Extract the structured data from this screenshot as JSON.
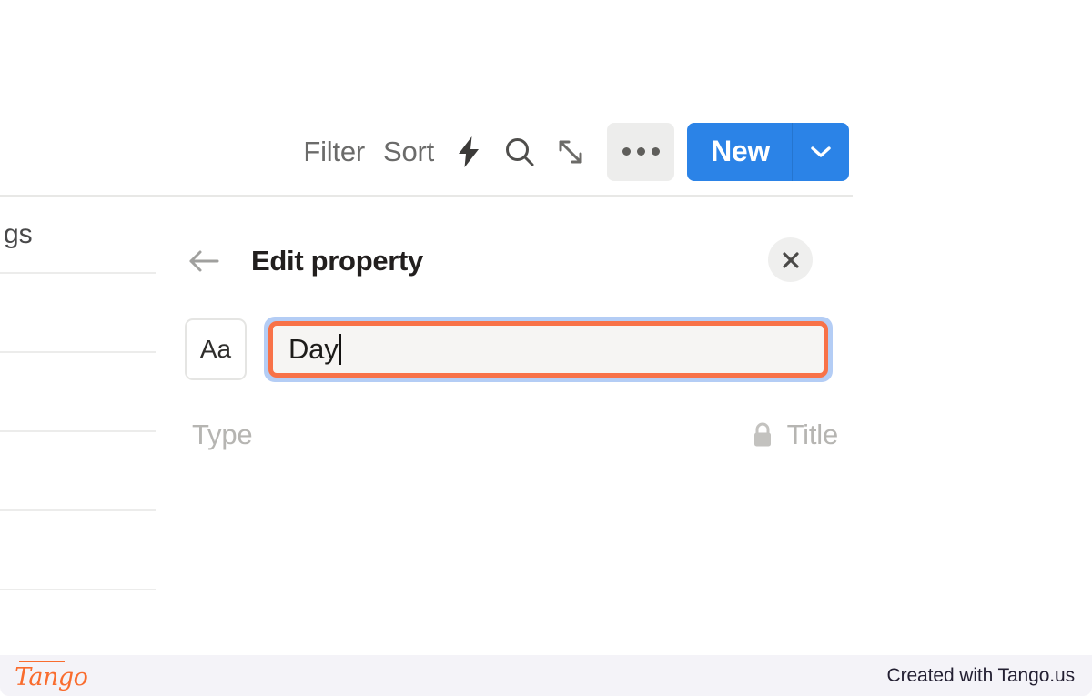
{
  "toolbar": {
    "filter_label": "Filter",
    "sort_label": "Sort",
    "automation_icon": "lightning-bolt-icon",
    "search_icon": "search-icon",
    "expand_icon": "expand-arrows-icon",
    "more_icon": "ellipsis-icon",
    "new_label": "New",
    "new_caret_icon": "chevron-down-icon",
    "new_button_color": "#2b83e7"
  },
  "table": {
    "rows": [
      {
        "text": "gs"
      },
      {
        "text": ""
      },
      {
        "text": ""
      },
      {
        "text": ""
      },
      {
        "text": ""
      },
      {
        "text": ""
      }
    ]
  },
  "panel": {
    "back_icon": "arrow-left-icon",
    "title": "Edit property",
    "close_icon": "close-icon",
    "type_chip_label": "Aa",
    "name_input": {
      "value": "Day",
      "placeholder": "Property name",
      "highlight_color": "#f87248",
      "focus_ring_color": "#b4cdf5"
    },
    "type_row": {
      "label": "Type",
      "lock_icon": "lock-icon",
      "value": "Title"
    }
  },
  "footer": {
    "logo_text": "Tango",
    "note": "Created with Tango.us",
    "logo_color": "#f96c2e",
    "background": "#f4f3f8"
  }
}
